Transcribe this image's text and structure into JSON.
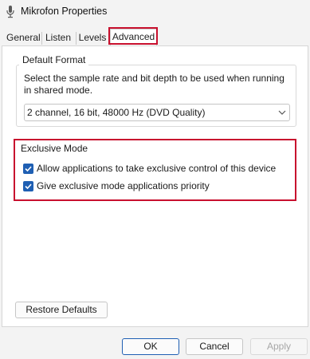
{
  "window": {
    "title": "Mikrofon Properties"
  },
  "tabs": [
    {
      "label": "General"
    },
    {
      "label": "Listen"
    },
    {
      "label": "Levels"
    },
    {
      "label": "Advanced"
    }
  ],
  "default_format": {
    "group_title": "Default Format",
    "description": "Select the sample rate and bit depth to be used when running in shared mode.",
    "selected_format": "2 channel, 16 bit, 48000 Hz (DVD Quality)"
  },
  "exclusive_mode": {
    "group_title": "Exclusive Mode",
    "options": [
      {
        "label": "Allow applications to take exclusive control of this device",
        "checked": true
      },
      {
        "label": "Give exclusive mode applications priority",
        "checked": true
      }
    ]
  },
  "buttons": {
    "restore": "Restore Defaults",
    "ok": "OK",
    "cancel": "Cancel",
    "apply": "Apply"
  },
  "colors": {
    "accent": "#1f5fb3",
    "highlight": "#c8102e"
  }
}
